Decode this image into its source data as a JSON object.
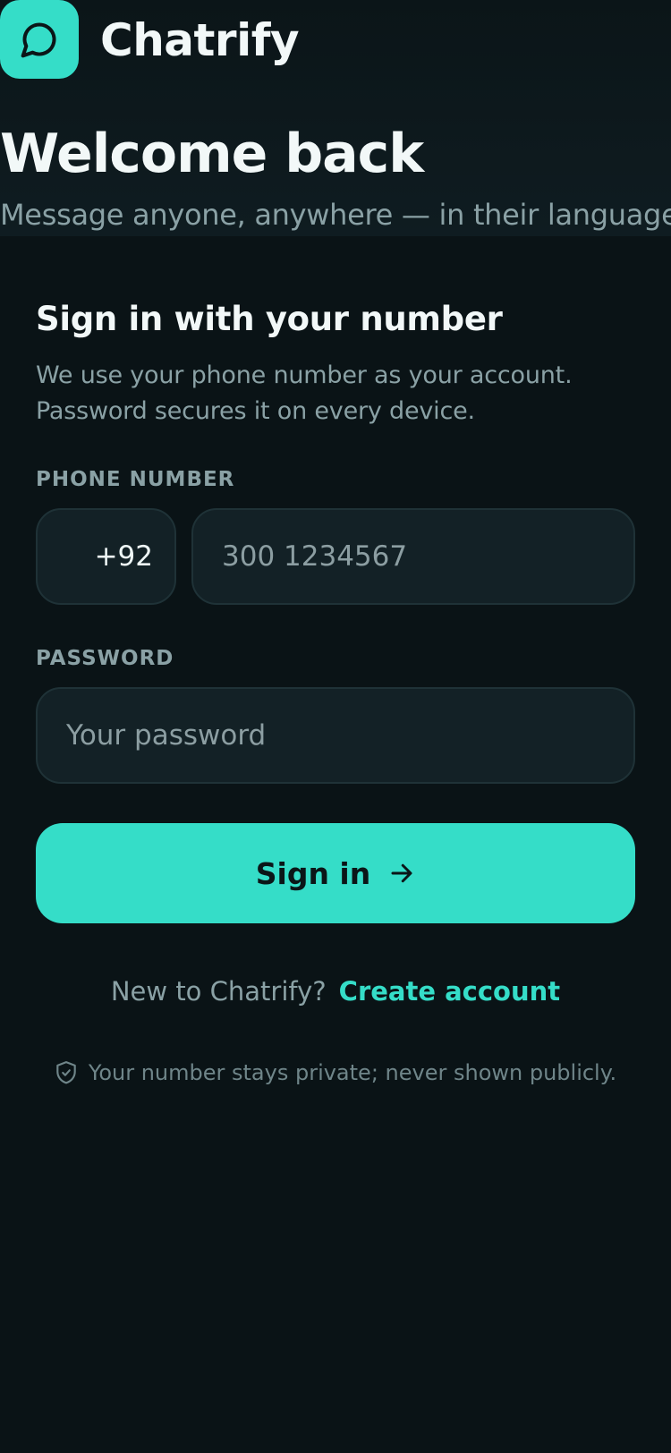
{
  "brand": {
    "name": "Chatrify",
    "logo_icon": "chat-bubble-icon",
    "accent_color": "#35ddc8"
  },
  "hero": {
    "title": "Welcome back",
    "tagline": "Message anyone, anywhere — in their language."
  },
  "card": {
    "title": "Sign in with your number",
    "description": "We use your phone number as your account. Password secures it on every device."
  },
  "phone": {
    "label": "PHONE NUMBER",
    "country_code": "+92",
    "placeholder": "300 1234567",
    "value": ""
  },
  "password": {
    "label": "PASSWORD",
    "placeholder": "Your password",
    "value": ""
  },
  "signin": {
    "label": "Sign in",
    "icon": "arrow-right-icon"
  },
  "signup": {
    "question": "New to Chatrify?",
    "link": "Create account"
  },
  "privacy": {
    "icon": "shield-check-icon",
    "text": "Your number stays private; never shown publicly."
  }
}
